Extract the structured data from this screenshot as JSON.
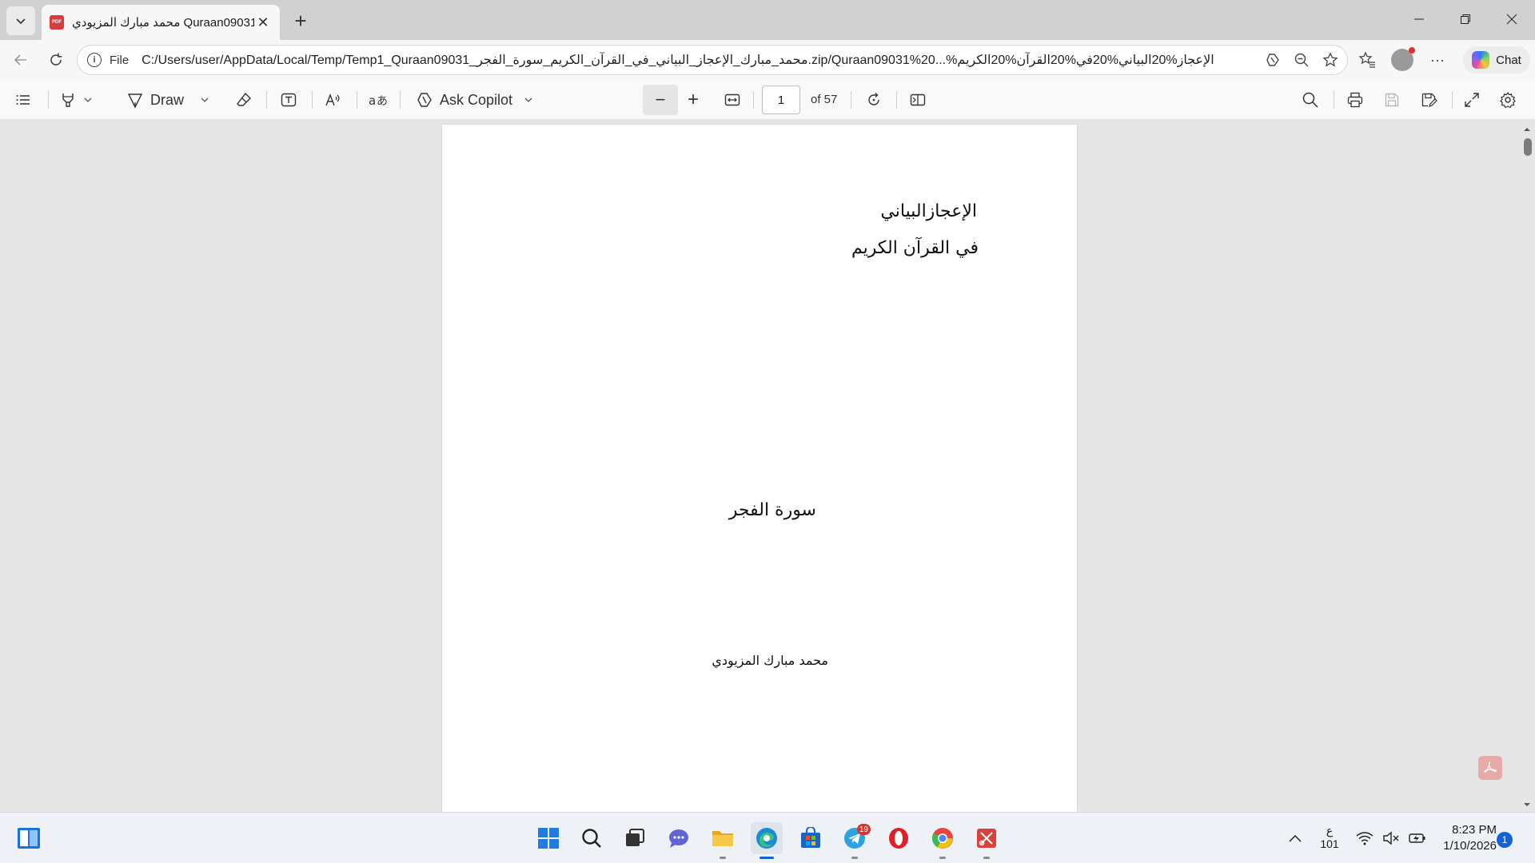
{
  "browser": {
    "tab_title": "محمد مبارك المزيودي Quraan09031",
    "tab_icon_text": "PDF",
    "address": {
      "scheme_label": "File",
      "url": "C:/Users/user/AppData/Local/Temp/Temp1_Quraan09031_محمد_مبارك_الإعجاز_البياني_في_القرآن_الكريم_سورة_الفجر.zip/Quraan09031%20...%الإعجاز%20البياني%20في%20القرآن%20الكريم"
    },
    "chat_label": "Chat"
  },
  "pdf_toolbar": {
    "draw_label": "Draw",
    "copilot_label": "Ask Copilot",
    "page_current": "1",
    "page_total": "of 57"
  },
  "document": {
    "title_line1": "الإعجازالبياني",
    "title_line2": "في القرآن الكريم",
    "surah": "سورة الفجر",
    "author": "محمد مبارك المزيودي"
  },
  "taskbar": {
    "telegram_badge": "19",
    "lang_top": "ع",
    "lang_bottom": "101",
    "time": "8:23 PM",
    "date": "1/10/2026",
    "notification_count": "1"
  },
  "colors": {
    "accent": "#1560d4",
    "pdf_red": "#d93b3b"
  }
}
